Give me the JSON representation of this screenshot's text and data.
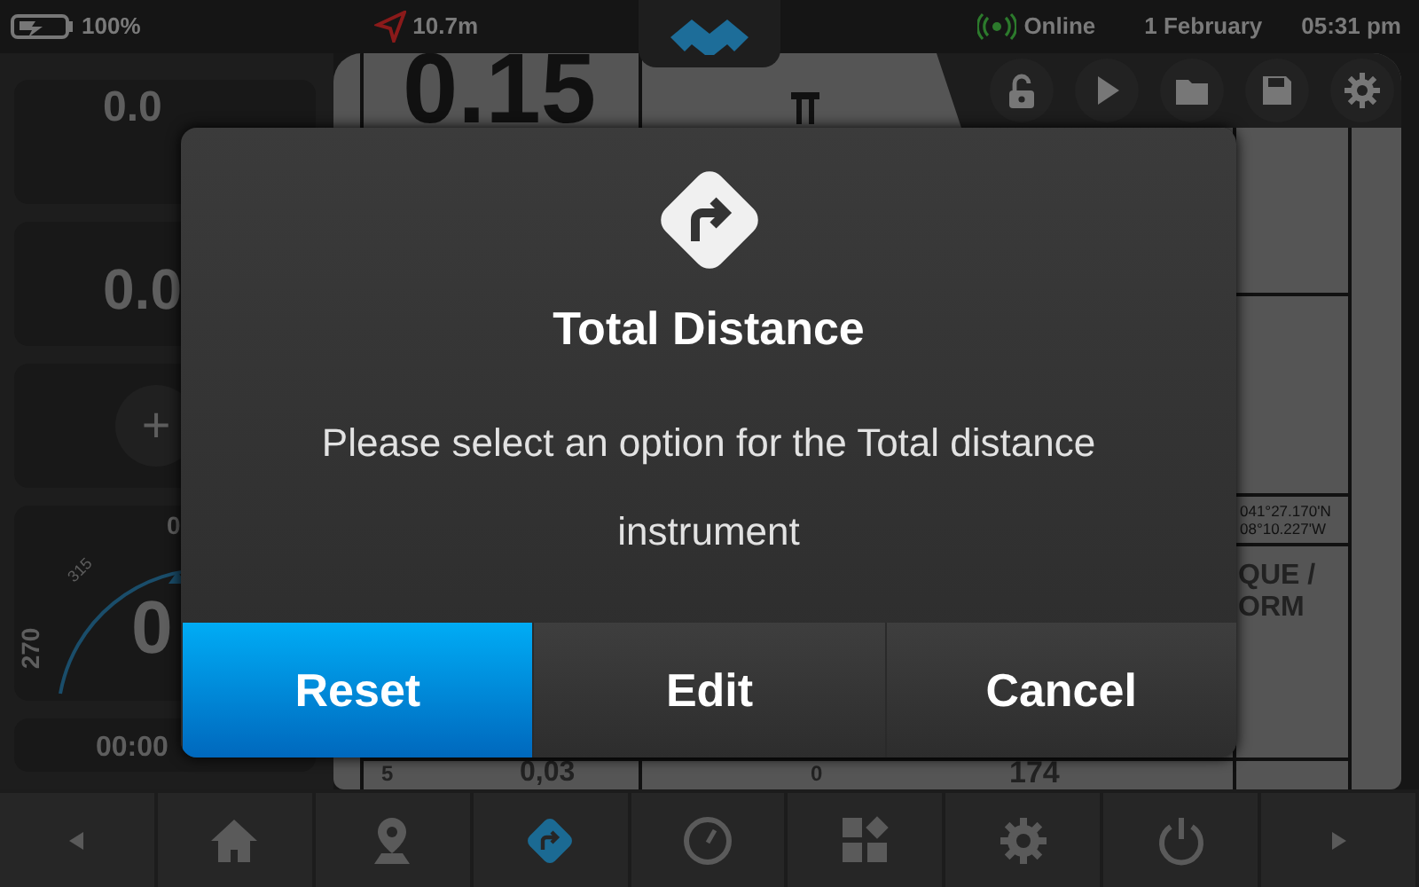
{
  "status_bar": {
    "battery": "100%",
    "gps_accuracy": "10.7m",
    "connection": "Online",
    "date": "1 February",
    "time": "05:31 pm"
  },
  "left_panel": {
    "cards": [
      {
        "kind": "value",
        "text": "0.0"
      },
      {
        "kind": "value",
        "text": "0.0"
      },
      {
        "kind": "add",
        "text": "+"
      },
      {
        "kind": "compass",
        "north": "0",
        "northwest": "315",
        "west": "270",
        "heading": "0"
      },
      {
        "kind": "timer",
        "text": "00:00"
      }
    ]
  },
  "main_panel": {
    "speed": "0.15",
    "coordinates": [
      "041°27.170'N",
      "08°10.227'W"
    ],
    "label_lines": [
      "QUE /",
      "ORM"
    ],
    "bottom_row": [
      "5",
      "0,03",
      "0",
      "174"
    ]
  },
  "toolbar": [
    {
      "kind": "unlock"
    },
    {
      "kind": "play"
    },
    {
      "kind": "folder"
    },
    {
      "kind": "save"
    },
    {
      "kind": "settings"
    }
  ],
  "dialog": {
    "title": "Total Distance",
    "message": "Please select an option for the Total distance instrument",
    "buttons": [
      {
        "label": "Reset",
        "selected": true
      },
      {
        "label": "Edit",
        "selected": false
      },
      {
        "label": "Cancel",
        "selected": false
      }
    ]
  },
  "bottom_nav": [
    {
      "kind": "previous",
      "selected": false
    },
    {
      "kind": "home",
      "selected": false
    },
    {
      "kind": "location",
      "selected": false
    },
    {
      "kind": "route",
      "selected": true
    },
    {
      "kind": "gauge",
      "selected": false
    },
    {
      "kind": "widgets",
      "selected": false
    },
    {
      "kind": "settings",
      "selected": false
    },
    {
      "kind": "power",
      "selected": false
    },
    {
      "kind": "next",
      "selected": false
    }
  ]
}
